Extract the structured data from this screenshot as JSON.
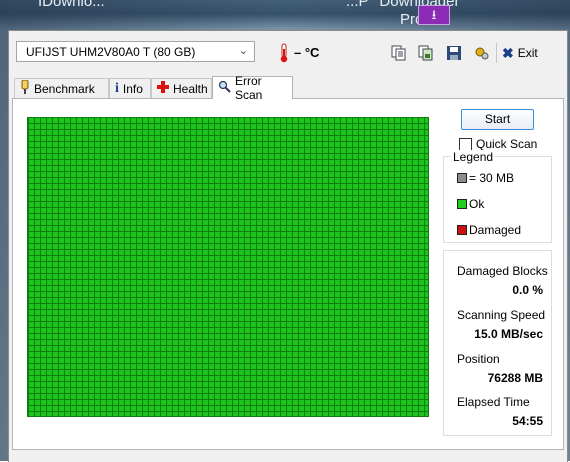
{
  "background": {
    "label_left": "IDownlo...",
    "label_right": "...P ' Downloader",
    "label_pro": "Pro"
  },
  "drive": {
    "selected": "UFIJST UHM2V80A0 T (80 GB)"
  },
  "temperature": {
    "value": "– °C"
  },
  "toolbar": {
    "exit_label": "Exit"
  },
  "tabs": [
    {
      "label": "Benchmark",
      "icon": "stopwatch-icon"
    },
    {
      "label": "Info",
      "icon": "info-icon"
    },
    {
      "label": "Health",
      "icon": "health-cross-icon"
    },
    {
      "label": "Error Scan",
      "icon": "magnifier-icon",
      "active": true
    }
  ],
  "scan": {
    "start_label": "Start",
    "quick_scan_label": "Quick Scan",
    "quick_scan_checked": false
  },
  "legend": {
    "title": "Legend",
    "items": [
      {
        "label": "= 30 MB",
        "color": "#8c8c8c"
      },
      {
        "label": "Ok",
        "color": "#22cc22"
      },
      {
        "label": "Damaged",
        "color": "#cc1111"
      }
    ]
  },
  "stats": {
    "damaged_blocks_label": "Damaged Blocks",
    "damaged_blocks_value": "0.0 %",
    "speed_label": "Scanning Speed",
    "speed_value": "15.0 MB/sec",
    "position_label": "Position",
    "position_value": "76288 MB",
    "elapsed_label": "Elapsed Time",
    "elapsed_value": "54:55"
  },
  "colors": {
    "ok_block": "#1ec41e",
    "grid_line": "#0e7d0e",
    "accent": "#3d8edb"
  }
}
